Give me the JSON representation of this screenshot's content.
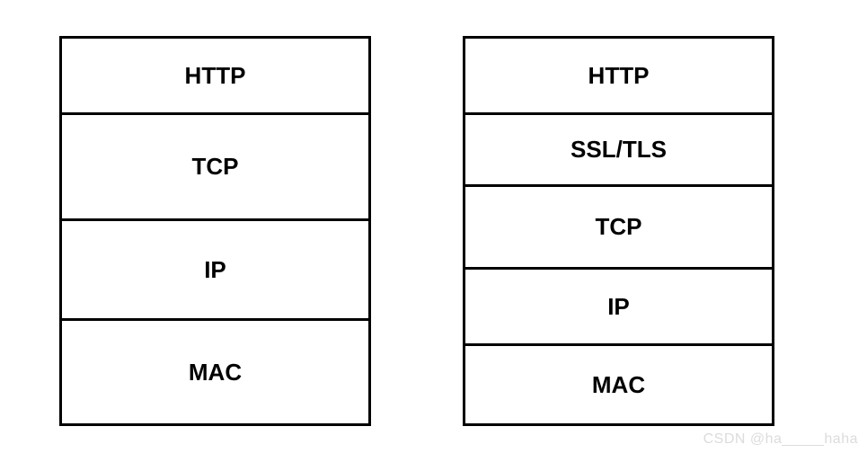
{
  "stacks": {
    "left": {
      "layers": [
        "HTTP",
        "TCP",
        "IP",
        "MAC"
      ]
    },
    "right": {
      "layers": [
        "HTTP",
        "SSL/TLS",
        "TCP",
        "IP",
        "MAC"
      ]
    }
  },
  "watermark": "CSDN @ha_____haha"
}
